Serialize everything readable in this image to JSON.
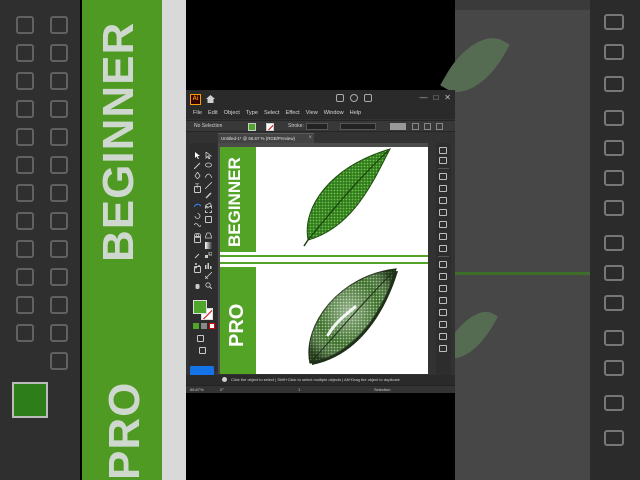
{
  "app": {
    "logo": "Ai",
    "window_controls": [
      "—",
      "□",
      "✕"
    ]
  },
  "menu": [
    "File",
    "Edit",
    "Object",
    "Type",
    "Select",
    "Effect",
    "View",
    "Window",
    "Help"
  ],
  "control_bar": {
    "selection_state": "No Selection",
    "stroke_label": "Stroke:",
    "fill_color": "#4fa62a"
  },
  "document": {
    "tab_label": "Untitled-1* @ 66.67 % (RGB/Preview)",
    "tab_close": "×"
  },
  "artboard": {
    "top_label": "BEGINNER",
    "bottom_label": "PRO",
    "panel_color": "#52a326"
  },
  "background_labels": {
    "top": "BEGINNER",
    "bottom": "PRO"
  },
  "status": {
    "hint": "Click the object to select  |  Shift+Click to select multiple objects  |  Alt+Drag the object to duplicate",
    "zoom": "66.67%",
    "rotation": "0°",
    "page": "1",
    "tool": "Selection"
  },
  "icons": {
    "left_tools": [
      "selection-tool-icon",
      "direct-selection-tool-icon",
      "magic-wand-icon",
      "lasso-icon",
      "pen-tool-icon",
      "curvature-tool-icon",
      "type-tool-icon",
      "line-tool-icon",
      "rectangle-tool-icon",
      "paintbrush-icon",
      "shaper-icon",
      "pencil-icon",
      "eraser-icon",
      "rotate-icon",
      "scale-icon",
      "warp-icon",
      "free-transform-icon",
      "shape-builder-icon",
      "perspective-icon",
      "mesh-icon",
      "gradient-icon",
      "eyedropper-icon",
      "blend-icon",
      "symbol-sprayer-icon",
      "column-graph-icon",
      "artboard-tool-icon",
      "slice-icon",
      "hand-icon",
      "zoom-icon"
    ],
    "right_panels": [
      "properties-icon",
      "layers-icon",
      "libraries-icon",
      "color-icon",
      "color-guide-icon",
      "swatches-icon",
      "brushes-icon",
      "symbols-icon",
      "graphic-styles-icon",
      "stroke-icon",
      "gradient-panel-icon",
      "transparency-icon",
      "appearance-icon",
      "align-icon",
      "pathfinder-icon",
      "transform-icon",
      "links-icon"
    ]
  }
}
